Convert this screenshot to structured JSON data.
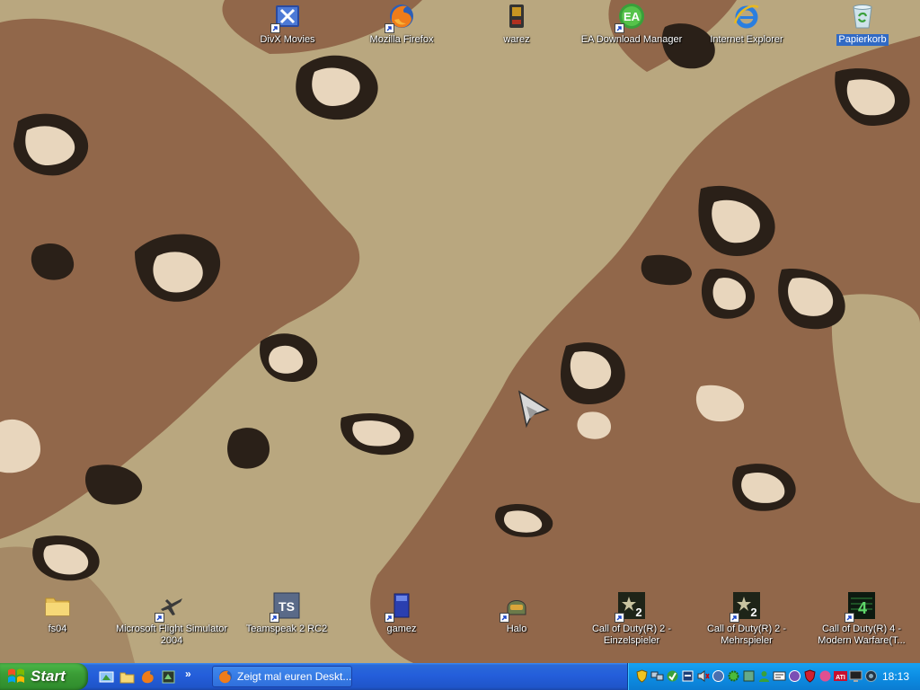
{
  "desktop": {
    "top_icons": [
      {
        "label": "DivX Movies",
        "icon": "divx-icon"
      },
      {
        "label": "Mozilla Firefox",
        "icon": "firefox-icon"
      },
      {
        "label": "warez",
        "icon": "device-icon"
      },
      {
        "label": "EA Download Manager",
        "icon": "ea-icon"
      },
      {
        "label": "Internet Explorer",
        "icon": "ie-icon"
      },
      {
        "label": "Papierkorb",
        "icon": "recycle-bin-icon"
      }
    ],
    "bottom_icons": [
      {
        "label": "fs04",
        "icon": "folder-icon"
      },
      {
        "label": "Microsoft Flight Simulator 2004",
        "icon": "airplane-icon"
      },
      {
        "label": "Teamspeak 2 RC2",
        "icon": "teamspeak-icon"
      },
      {
        "label": "gamez",
        "icon": "book-icon"
      },
      {
        "label": "Halo",
        "icon": "helmet-icon"
      },
      {
        "label": "Call of Duty(R) 2 - Einzelspieler",
        "icon": "cod2-icon"
      },
      {
        "label": "Call of Duty(R) 2 - Mehrspieler",
        "icon": "cod2-icon"
      },
      {
        "label": "Call of Duty(R) 4 - Modern Warfare(T...",
        "icon": "cod4-icon"
      }
    ],
    "teamspeak_icon_text": "TS",
    "cod2_icon_text": "2",
    "cod4_icon_text": "4"
  },
  "taskbar": {
    "start_label": "Start",
    "quick_launch": [
      "show-desktop-icon",
      "folder-icon",
      "firefox-icon",
      "app-icon"
    ],
    "quick_launch_more": "»",
    "task_button": {
      "label": "Zeigt mal euren Deskt...",
      "icon": "firefox-icon"
    },
    "tray_icons": [
      "shield-icon",
      "network-icon",
      "update-icon",
      "security-icon",
      "volume-icon",
      "app-icon",
      "gear-icon",
      "app-icon",
      "user-icon",
      "app-icon",
      "app-icon",
      "shield-icon",
      "app-icon",
      "ati-icon",
      "monitor-icon",
      "app-icon"
    ],
    "tray_ati_text": "ATI",
    "clock": "18:13"
  },
  "colors": {
    "taskbar": "#245edb",
    "start_button": "#3b9d36",
    "tray": "#0d8de3",
    "camo_sand": "#b9a77f",
    "camo_brown": "#91674a",
    "camo_dark": "#2a2018",
    "camo_light": "#e8d6bd",
    "selection": "#316ac5"
  }
}
